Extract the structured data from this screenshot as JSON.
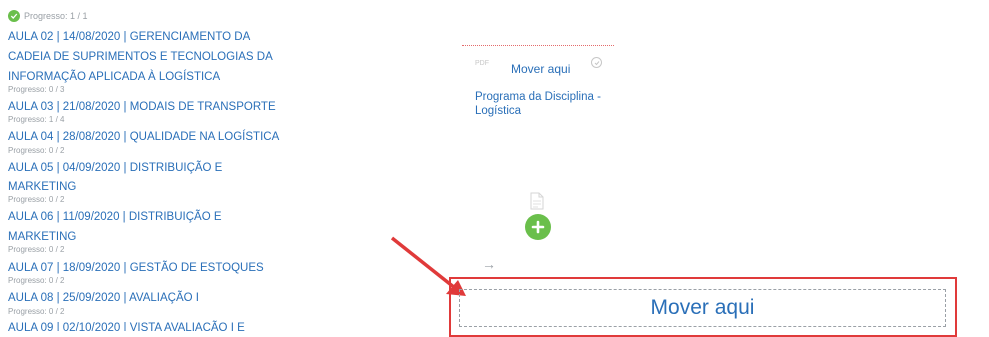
{
  "lessons": {
    "first_progress": "Progresso: 1 / 1",
    "items": [
      {
        "title_lines": [
          "AULA 02 | 14/08/2020 | GERENCIAMENTO DA",
          "CADEIA DE SUPRIMENTOS E TECNOLOGIAS DA",
          "INFORMAÇÃO APLICADA À LOGÍSTICA"
        ],
        "progress": "Progresso: 0 / 3"
      },
      {
        "title_lines": [
          "AULA 03 | 21/08/2020 | MODAIS DE TRANSPORTE"
        ],
        "progress": "Progresso: 1 / 4"
      },
      {
        "title_lines": [
          "AULA 04 | 28/08/2020 | QUALIDADE NA LOGÍSTICA"
        ],
        "progress": "Progresso: 0 / 2"
      },
      {
        "title_lines": [
          "AULA 05 | 04/09/2020 | DISTRIBUIÇÃO E",
          "MARKETING"
        ],
        "progress": "Progresso: 0 / 2"
      },
      {
        "title_lines": [
          "AULA 06 | 11/09/2020 | DISTRIBUIÇÃO E",
          "MARKETING"
        ],
        "progress": "Progresso: 0 / 2"
      },
      {
        "title_lines": [
          "AULA 07 | 18/09/2020 | GESTÃO DE ESTOQUES"
        ],
        "progress": "Progresso: 0 / 2"
      },
      {
        "title_lines": [
          "AULA 08 | 25/09/2020 | AVALIAÇÃO I"
        ],
        "progress": "Progresso: 0 / 2"
      },
      {
        "title_lines": [
          "AULA 09 | 02/10/2020 | VISTA AVALIAÇÃO I E"
        ],
        "progress": ""
      }
    ]
  },
  "content": {
    "pdf_label": "PDF",
    "mover_small": "Mover aqui",
    "program_title": "Programa da Disciplina - Logística",
    "drop_target": "Mover aqui"
  },
  "colors": {
    "link": "#2a6fb8",
    "green": "#6abf4b",
    "annotation_red": "#e03a3a"
  },
  "icons": {
    "completed": "check-circle-icon",
    "document": "document-icon",
    "add": "plus-circle-icon",
    "arrow": "arrow-right-icon",
    "annotation": "red-arrow-annotation"
  }
}
